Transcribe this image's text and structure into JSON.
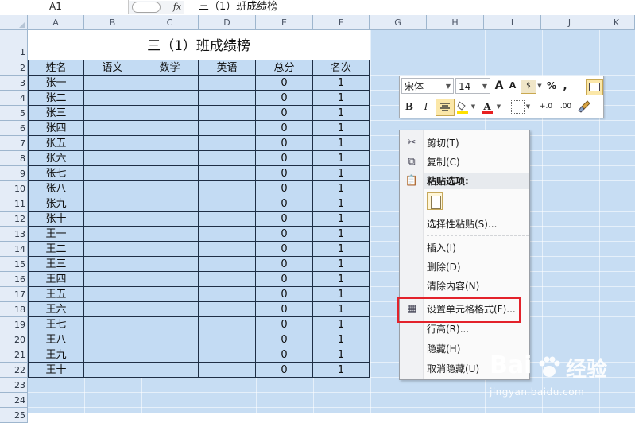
{
  "formula_bar": {
    "name_box": "A1",
    "fx_label": "fx",
    "content": "三（1）班成绩榜"
  },
  "columns": [
    "A",
    "B",
    "C",
    "D",
    "E",
    "F",
    "G",
    "H",
    "I",
    "J",
    "K"
  ],
  "rows": [
    "1",
    "2",
    "3",
    "4",
    "5",
    "6",
    "7",
    "8",
    "9",
    "10",
    "11",
    "12",
    "13",
    "14",
    "15",
    "16",
    "17",
    "18",
    "19",
    "20",
    "21",
    "22",
    "23",
    "24",
    "25"
  ],
  "sheet": {
    "title": "三（1）班成绩榜",
    "headers": [
      "姓名",
      "语文",
      "数学",
      "英语",
      "总分",
      "名次"
    ],
    "data": [
      [
        "张一",
        "",
        "",
        "",
        "0",
        "1"
      ],
      [
        "张二",
        "",
        "",
        "",
        "0",
        "1"
      ],
      [
        "张三",
        "",
        "",
        "",
        "0",
        "1"
      ],
      [
        "张四",
        "",
        "",
        "",
        "0",
        "1"
      ],
      [
        "张五",
        "",
        "",
        "",
        "0",
        "1"
      ],
      [
        "张六",
        "",
        "",
        "",
        "0",
        "1"
      ],
      [
        "张七",
        "",
        "",
        "",
        "0",
        "1"
      ],
      [
        "张八",
        "",
        "",
        "",
        "0",
        "1"
      ],
      [
        "张九",
        "",
        "",
        "",
        "0",
        "1"
      ],
      [
        "张十",
        "",
        "",
        "",
        "0",
        "1"
      ],
      [
        "王一",
        "",
        "",
        "",
        "0",
        "1"
      ],
      [
        "王二",
        "",
        "",
        "",
        "0",
        "1"
      ],
      [
        "王三",
        "",
        "",
        "",
        "0",
        "1"
      ],
      [
        "王四",
        "",
        "",
        "",
        "0",
        "1"
      ],
      [
        "王五",
        "",
        "",
        "",
        "0",
        "1"
      ],
      [
        "王六",
        "",
        "",
        "",
        "0",
        "1"
      ],
      [
        "王七",
        "",
        "",
        "",
        "0",
        "1"
      ],
      [
        "王八",
        "",
        "",
        "",
        "0",
        "1"
      ],
      [
        "王九",
        "",
        "",
        "",
        "0",
        "1"
      ],
      [
        "王十",
        "",
        "",
        "",
        "0",
        "1"
      ]
    ]
  },
  "mini_toolbar": {
    "font": "宋体",
    "size": "14",
    "grow_font": "A",
    "shrink_font": "A",
    "percent": "%",
    "comma": ",",
    "bold": "B",
    "italic": "I",
    "font_color": "A",
    "increase_decimal": "+.0",
    "decrease_decimal": ".00",
    "accent_color": "#e82020",
    "fill_color": "#ffe000"
  },
  "context_menu": {
    "cut": "剪切(T)",
    "copy": "复制(C)",
    "paste_options": "粘贴选项:",
    "paste_special": "选择性粘贴(S)...",
    "insert": "插入(I)",
    "delete": "删除(D)",
    "clear": "清除内容(N)",
    "format_cells": "设置单元格格式(F)...",
    "row_height": "行高(R)...",
    "hide": "隐藏(H)",
    "unhide": "取消隐藏(U)"
  },
  "watermark": {
    "brand_left": "Bai",
    "brand_right": "经验",
    "url": "jingyan.baidu.com"
  }
}
